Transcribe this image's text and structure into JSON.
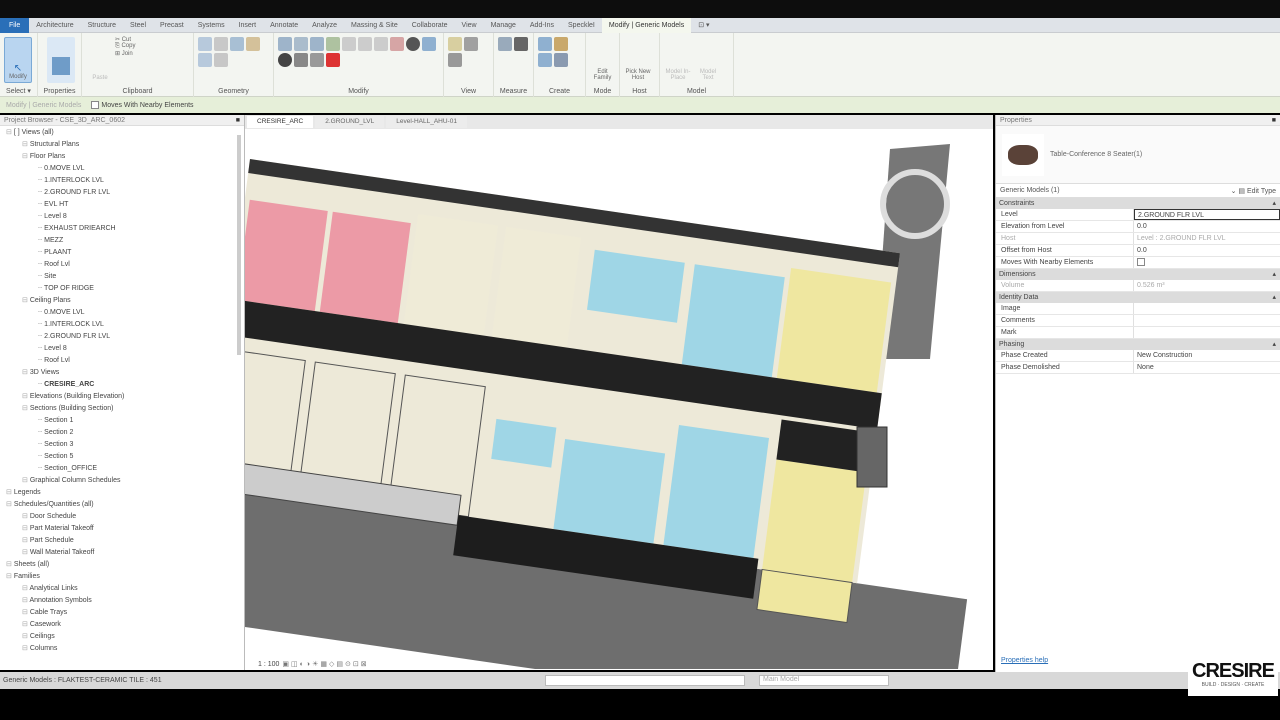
{
  "ribbon": {
    "tabs": [
      "File",
      "Architecture",
      "Structure",
      "Steel",
      "Precast",
      "Systems",
      "Insert",
      "Annotate",
      "Analyze",
      "Massing & Site",
      "Collaborate",
      "View",
      "Manage",
      "Add-Ins",
      "SpeckleI",
      "Modify | Generic Models",
      "⊡ ▾"
    ],
    "active_tab": "Modify | Generic Models",
    "panels": [
      "Select ▾",
      "Properties",
      "Clipboard",
      "Geometry",
      "Modify",
      "View",
      "Measure",
      "Create",
      "Mode",
      "Host",
      "Model"
    ],
    "buttons": {
      "modify": "Modify",
      "paste": "Paste",
      "copy": "Copy",
      "cut": "Cut",
      "join": "Join",
      "edit_family": "Edit Family",
      "pick_new_host": "Pick New Host",
      "model_in_place": "Model In-Place",
      "model_text": "Model Text"
    }
  },
  "options_bar": {
    "label": "Modify | Generic Models",
    "moves_with_nearby": "Moves With Nearby Elements"
  },
  "browser": {
    "title": "Project Browser - CSE_3D_ARC_0602",
    "items": [
      {
        "t": "[ ] Views (all)",
        "d": 0
      },
      {
        "t": "Structural Plans",
        "d": 1
      },
      {
        "t": "Floor Plans",
        "d": 1
      },
      {
        "t": "0.MOVE LVL",
        "d": 2
      },
      {
        "t": "1.INTERLOCK LVL",
        "d": 2
      },
      {
        "t": "2.GROUND FLR LVL",
        "d": 2
      },
      {
        "t": "EVL HT",
        "d": 2
      },
      {
        "t": "Level 8",
        "d": 2
      },
      {
        "t": "EXHAUST DRIEARCH",
        "d": 2
      },
      {
        "t": "MEZZ",
        "d": 2
      },
      {
        "t": "PLAANT",
        "d": 2
      },
      {
        "t": "Roof Lvl",
        "d": 2
      },
      {
        "t": "Site",
        "d": 2
      },
      {
        "t": "TOP OF RIDGE",
        "d": 2
      },
      {
        "t": "Ceiling Plans",
        "d": 1
      },
      {
        "t": "0.MOVE LVL",
        "d": 2
      },
      {
        "t": "1.INTERLOCK LVL",
        "d": 2
      },
      {
        "t": "2.GROUND FLR LVL",
        "d": 2
      },
      {
        "t": "Level 8",
        "d": 2
      },
      {
        "t": "Roof Lvl",
        "d": 2
      },
      {
        "t": "3D Views",
        "d": 1
      },
      {
        "t": "CRESIRE_ARC",
        "d": 2,
        "b": true
      },
      {
        "t": "Elevations (Building Elevation)",
        "d": 1
      },
      {
        "t": "Sections (Building Section)",
        "d": 1
      },
      {
        "t": "Section 1",
        "d": 2
      },
      {
        "t": "Section 2",
        "d": 2
      },
      {
        "t": "Section 3",
        "d": 2
      },
      {
        "t": "Section 5",
        "d": 2
      },
      {
        "t": "Section_OFFICE",
        "d": 2
      },
      {
        "t": "Graphical Column Schedules",
        "d": 1
      },
      {
        "t": "Legends",
        "d": 0
      },
      {
        "t": "Schedules/Quantities (all)",
        "d": 0
      },
      {
        "t": "Door Schedule",
        "d": 1
      },
      {
        "t": "Part Material Takeoff",
        "d": 1
      },
      {
        "t": "Part Schedule",
        "d": 1
      },
      {
        "t": "Wall Material Takeoff",
        "d": 1
      },
      {
        "t": "Sheets (all)",
        "d": 0
      },
      {
        "t": "Families",
        "d": 0
      },
      {
        "t": "Analytical Links",
        "d": 1
      },
      {
        "t": "Annotation Symbols",
        "d": 1
      },
      {
        "t": "Cable Trays",
        "d": 1
      },
      {
        "t": "Casework",
        "d": 1
      },
      {
        "t": "Ceilings",
        "d": 1
      },
      {
        "t": "Columns",
        "d": 1
      }
    ]
  },
  "view_tabs": [
    "CRESIRE_ARC",
    "2.GROUND_LVL",
    "Level-HALL_AHU-01"
  ],
  "view_controls": {
    "scale": "1 : 100"
  },
  "properties": {
    "title": "Properties",
    "type_name": "Table-Conference 8 Seater(1)",
    "selector": "Generic Models (1)",
    "edit_type": "Edit Type",
    "groups": [
      {
        "name": "Constraints",
        "rows": [
          [
            "Level",
            "2.GROUND FLR LVL"
          ],
          [
            "Elevation from Level",
            "0.0"
          ],
          [
            "Host",
            "Level : 2.GROUND FLR LVL"
          ],
          [
            "Offset from Host",
            "0.0"
          ],
          [
            "Moves With Nearby Elements",
            ""
          ]
        ]
      },
      {
        "name": "Dimensions",
        "rows": [
          [
            "Volume",
            "0.526 m³"
          ]
        ]
      },
      {
        "name": "Identity Data",
        "rows": [
          [
            "Image",
            ""
          ],
          [
            "Comments",
            ""
          ],
          [
            "Mark",
            ""
          ]
        ]
      },
      {
        "name": "Phasing",
        "rows": [
          [
            "Phase Created",
            "New Construction"
          ],
          [
            "Phase Demolished",
            "None"
          ]
        ]
      }
    ],
    "help_link": "Properties help"
  },
  "status": {
    "text": "Generic Models : FLAKTEST-CERAMIC TILE : 451",
    "workset_placeholder": "",
    "model": "Main Model"
  },
  "logo": {
    "name": "CRESIRE",
    "tagline": "BUILD · DESIGN · CREATE"
  }
}
